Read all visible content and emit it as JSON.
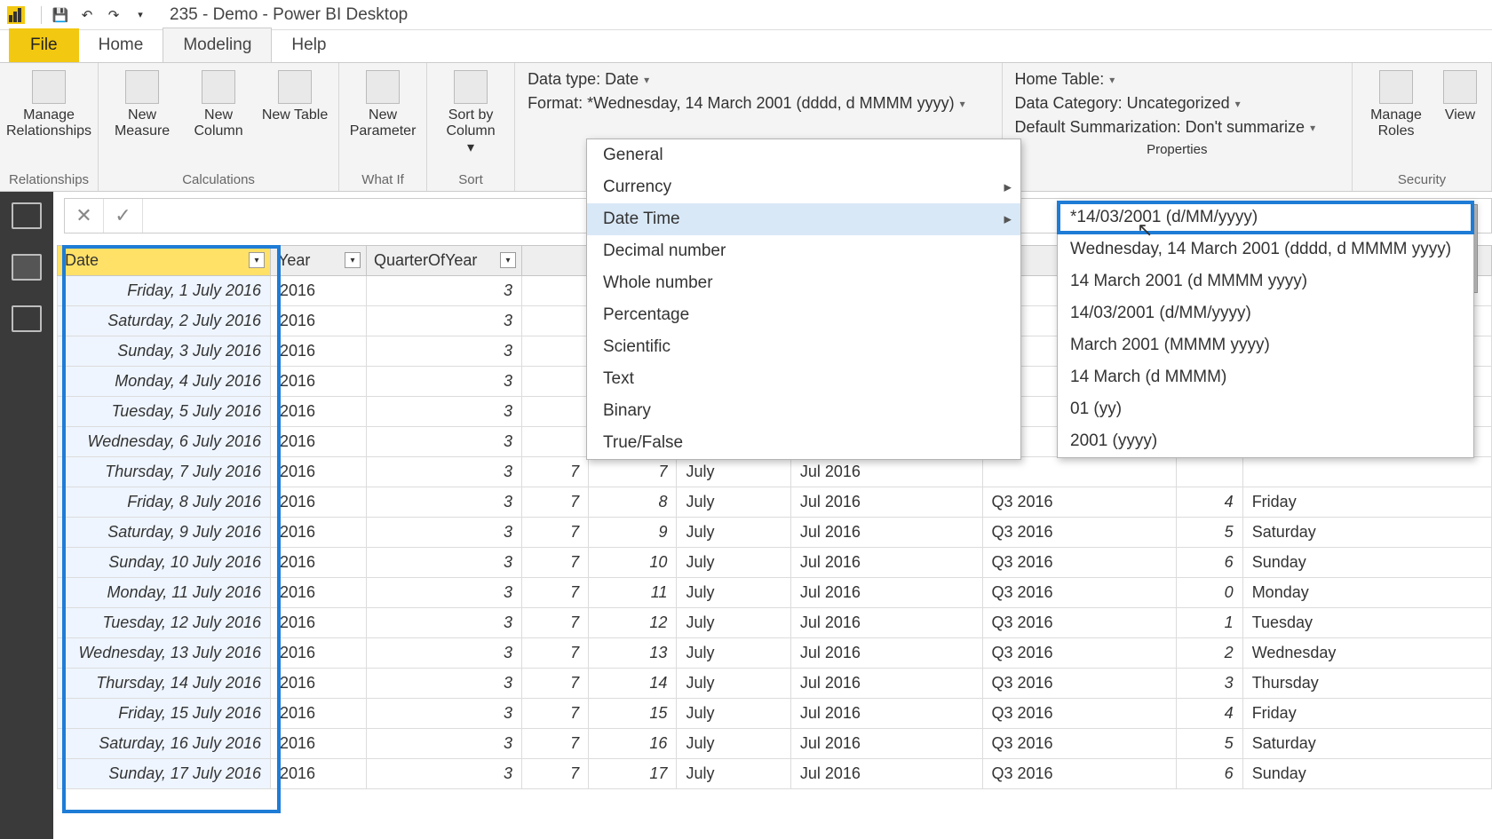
{
  "title": "235 - Demo - Power BI Desktop",
  "tabs": {
    "file": "File",
    "home": "Home",
    "modeling": "Modeling",
    "help": "Help"
  },
  "ribbon": {
    "relationships": {
      "manage": "Manage Relationships",
      "label": "Relationships"
    },
    "calculations": {
      "measure": "New Measure",
      "column": "New Column",
      "table": "New Table",
      "label": "Calculations"
    },
    "whatif": {
      "param": "New Parameter",
      "label": "What If"
    },
    "sort": {
      "sortby": "Sort by Column",
      "label": "Sort"
    },
    "formatting": {
      "datatype": "Data type: Date",
      "format": "Format: *Wednesday, 14 March 2001 (dddd, d MMMM yyyy)"
    },
    "properties": {
      "home_table": "Home Table:",
      "data_category": "Data Category: Uncategorized",
      "default_sum": "Default Summarization: Don't summarize",
      "label": "Properties"
    },
    "security": {
      "roles": "Manage Roles",
      "view": "View",
      "label": "Security"
    }
  },
  "format_menu": {
    "items": [
      "General",
      "Currency",
      "Date Time",
      "Decimal number",
      "Whole number",
      "Percentage",
      "Scientific",
      "Text",
      "Binary",
      "True/False"
    ],
    "highlighted": "Date Time"
  },
  "date_submenu": {
    "items": [
      "*14/03/2001 (d/MM/yyyy)",
      "Wednesday, 14 March 2001 (dddd, d MMMM yyyy)",
      "14 March 2001 (d MMMM yyyy)",
      "14/03/2001 (d/MM/yyyy)",
      "March 2001 (MMMM yyyy)",
      "14 March (d MMMM)",
      "01 (yy)",
      "2001 (yyyy)"
    ],
    "selected": 0
  },
  "columns": [
    "Date",
    "Year",
    "QuarterOfYear",
    "",
    "",
    "",
    "",
    "",
    "",
    ""
  ],
  "rows": [
    {
      "date": "Friday, 1 July 2016",
      "year": "2016",
      "q": "3",
      "m": "",
      "d": "",
      "mn": "",
      "my": "",
      "qt": "",
      "n": "",
      "dn": ""
    },
    {
      "date": "Saturday, 2 July 2016",
      "year": "2016",
      "q": "3",
      "m": "",
      "d": "",
      "mn": "",
      "my": "",
      "qt": "",
      "n": "",
      "dn": ""
    },
    {
      "date": "Sunday, 3 July 2016",
      "year": "2016",
      "q": "3",
      "m": "",
      "d": "",
      "mn": "",
      "my": "",
      "qt": "",
      "n": "",
      "dn": ""
    },
    {
      "date": "Monday, 4 July 2016",
      "year": "2016",
      "q": "3",
      "m": "",
      "d": "",
      "mn": "",
      "my": "",
      "qt": "",
      "n": "",
      "dn": ""
    },
    {
      "date": "Tuesday, 5 July 2016",
      "year": "2016",
      "q": "3",
      "m": "",
      "d": "",
      "mn": "",
      "my": "",
      "qt": "",
      "n": "",
      "dn": ""
    },
    {
      "date": "Wednesday, 6 July 2016",
      "year": "2016",
      "q": "3",
      "m": "",
      "d": "",
      "mn": "",
      "my": "",
      "qt": "",
      "n": "",
      "dn": ""
    },
    {
      "date": "Thursday, 7 July 2016",
      "year": "2016",
      "q": "3",
      "m": "7",
      "d": "7",
      "mn": "July",
      "my": "Jul 2016",
      "qt": "",
      "n": "",
      "dn": ""
    },
    {
      "date": "Friday, 8 July 2016",
      "year": "2016",
      "q": "3",
      "m": "7",
      "d": "8",
      "mn": "July",
      "my": "Jul 2016",
      "qt": "Q3 2016",
      "n": "4",
      "dn": "Friday"
    },
    {
      "date": "Saturday, 9 July 2016",
      "year": "2016",
      "q": "3",
      "m": "7",
      "d": "9",
      "mn": "July",
      "my": "Jul 2016",
      "qt": "Q3 2016",
      "n": "5",
      "dn": "Saturday"
    },
    {
      "date": "Sunday, 10 July 2016",
      "year": "2016",
      "q": "3",
      "m": "7",
      "d": "10",
      "mn": "July",
      "my": "Jul 2016",
      "qt": "Q3 2016",
      "n": "6",
      "dn": "Sunday"
    },
    {
      "date": "Monday, 11 July 2016",
      "year": "2016",
      "q": "3",
      "m": "7",
      "d": "11",
      "mn": "July",
      "my": "Jul 2016",
      "qt": "Q3 2016",
      "n": "0",
      "dn": "Monday"
    },
    {
      "date": "Tuesday, 12 July 2016",
      "year": "2016",
      "q": "3",
      "m": "7",
      "d": "12",
      "mn": "July",
      "my": "Jul 2016",
      "qt": "Q3 2016",
      "n": "1",
      "dn": "Tuesday"
    },
    {
      "date": "Wednesday, 13 July 2016",
      "year": "2016",
      "q": "3",
      "m": "7",
      "d": "13",
      "mn": "July",
      "my": "Jul 2016",
      "qt": "Q3 2016",
      "n": "2",
      "dn": "Wednesday"
    },
    {
      "date": "Thursday, 14 July 2016",
      "year": "2016",
      "q": "3",
      "m": "7",
      "d": "14",
      "mn": "July",
      "my": "Jul 2016",
      "qt": "Q3 2016",
      "n": "3",
      "dn": "Thursday"
    },
    {
      "date": "Friday, 15 July 2016",
      "year": "2016",
      "q": "3",
      "m": "7",
      "d": "15",
      "mn": "July",
      "my": "Jul 2016",
      "qt": "Q3 2016",
      "n": "4",
      "dn": "Friday"
    },
    {
      "date": "Saturday, 16 July 2016",
      "year": "2016",
      "q": "3",
      "m": "7",
      "d": "16",
      "mn": "July",
      "my": "Jul 2016",
      "qt": "Q3 2016",
      "n": "5",
      "dn": "Saturday"
    },
    {
      "date": "Sunday, 17 July 2016",
      "year": "2016",
      "q": "3",
      "m": "7",
      "d": "17",
      "mn": "July",
      "my": "Jul 2016",
      "qt": "Q3 2016",
      "n": "6",
      "dn": "Sunday"
    }
  ]
}
